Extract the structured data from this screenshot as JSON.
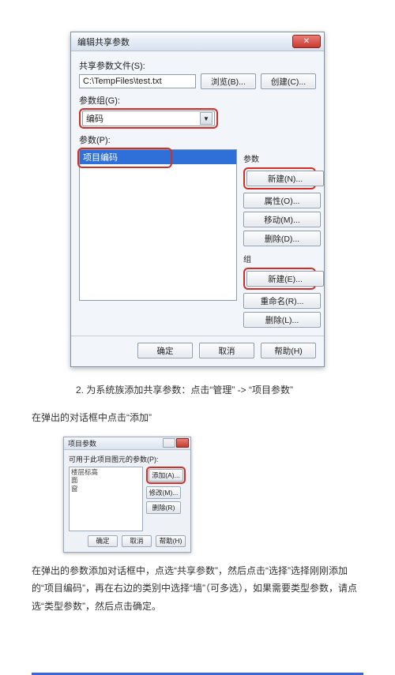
{
  "dialog1": {
    "title": "编辑共享参数",
    "file_label": "共享参数文件(S):",
    "file_path": "C:\\TempFiles\\test.txt",
    "browse": "浏览(B)...",
    "create": "创建(C)...",
    "group_label": "参数组(G):",
    "group_value": "编码",
    "params_label": "参数(P):",
    "selected_param": "项目编码",
    "right_section1": "参数",
    "btn_new_param": "新建(N)...",
    "btn_props": "属性(O)...",
    "btn_move": "移动(M)...",
    "btn_delete_param": "删除(D)...",
    "right_section2": "组",
    "btn_new_group": "新建(E)...",
    "btn_rename": "重命名(R)...",
    "btn_delete_group": "删除(L)...",
    "ok": "确定",
    "cancel": "取消",
    "help": "帮助(H)"
  },
  "text": {
    "step2": "2. 为系统族添加共享参数：点击“管理” -> “项目参数”",
    "step_popup": "在弹出的对话框中点击“添加”",
    "final": "在弹出的参数添加对话框中，点选“共享参数”，然后点击“选择”选择刚刚添加的“项目编码”，再在右边的类别中选择“墙”（可多选），如果需要类型参数，请点选“类型参数”，然后点击确定。"
  },
  "dialog2": {
    "title": "项目参数",
    "list_label": "可用于此项目图元的参数(P):",
    "items": [
      "楼层标高",
      "面",
      "窗",
      "…"
    ],
    "btn_add": "添加(A)...",
    "btn_mod": "修改(M)...",
    "btn_del": "删除(R)",
    "ok": "确定",
    "cancel": "取消",
    "help": "帮助(H)"
  }
}
